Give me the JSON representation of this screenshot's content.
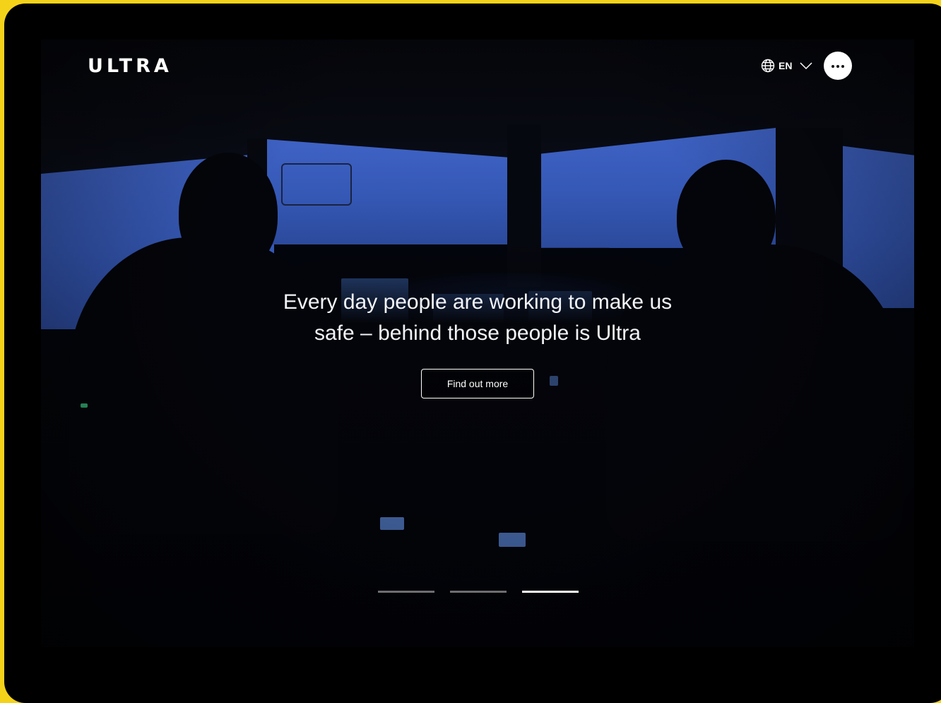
{
  "header": {
    "logo_text": "ULTRA",
    "language_label": "EN",
    "menu_icon": "more-dots-icon"
  },
  "hero": {
    "headline_line1": "Every day people are working to make us",
    "headline_line2": "safe – behind those people is Ultra",
    "cta_label": "Find out more"
  },
  "carousel": {
    "slides": 3,
    "active_index": 2
  },
  "colors": {
    "frame": "#f5d21a",
    "window_blue": "#3f63c6",
    "text": "#ffffff"
  }
}
